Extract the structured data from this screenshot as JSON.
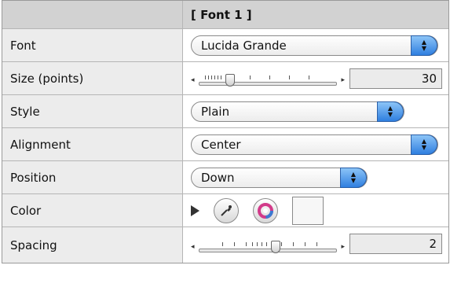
{
  "header": {
    "column_title": "[ Font 1 ]"
  },
  "rows": {
    "font": {
      "label": "Font",
      "value": "Lucida Grande"
    },
    "size": {
      "label": "Size (points)",
      "value": "30",
      "slider_fraction": 0.25
    },
    "style": {
      "label": "Style",
      "value": "Plain"
    },
    "alignment": {
      "label": "Alignment",
      "value": "Center"
    },
    "position": {
      "label": "Position",
      "value": "Down"
    },
    "color": {
      "label": "Color",
      "swatch_color": "#f7f7f7"
    },
    "spacing": {
      "label": "Spacing",
      "value": "2",
      "slider_fraction": 0.55
    }
  },
  "icons": {
    "expand": "disclosure-triangle",
    "eyedropper": "eyedropper-icon",
    "colorwheel": "color-wheel-icon",
    "popup_arrows": "up-down-arrows"
  },
  "colors": {
    "popup_accent": "#2f7fe0"
  }
}
